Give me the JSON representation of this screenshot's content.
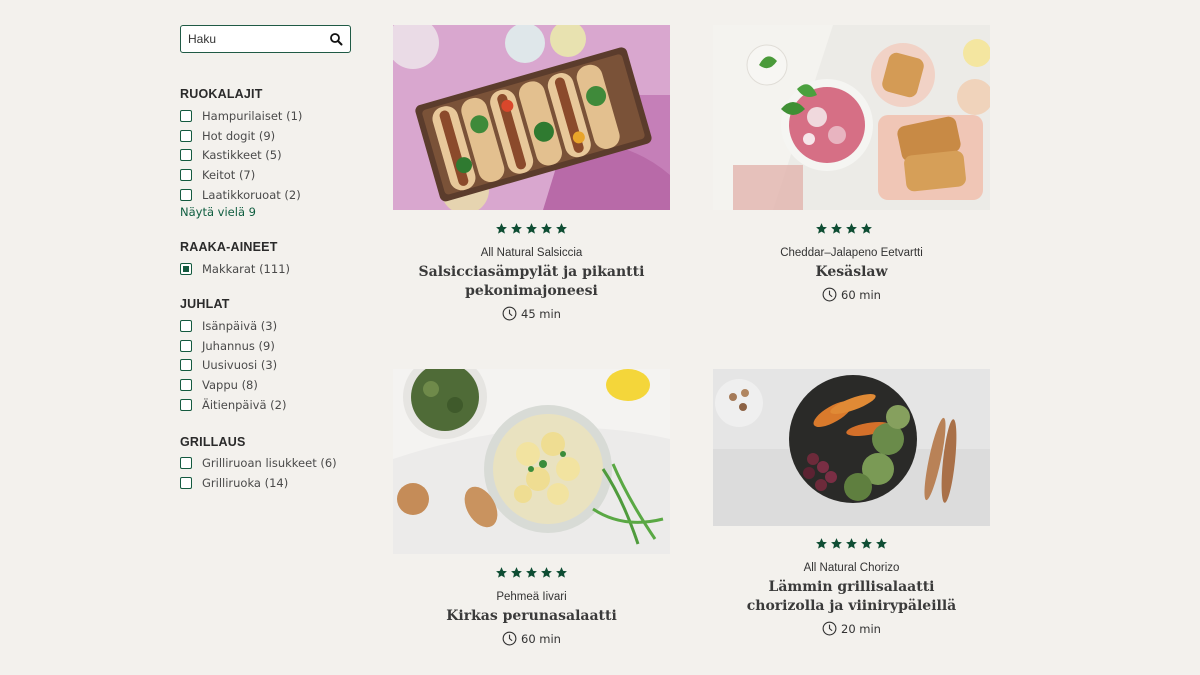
{
  "search": {
    "placeholder": "Haku"
  },
  "filters": [
    {
      "title": "RUOKALAJIT",
      "options": [
        {
          "label": "Hampurilaiset (1)",
          "checked": false
        },
        {
          "label": "Hot dogit (9)",
          "checked": false
        },
        {
          "label": "Kastikkeet (5)",
          "checked": false
        },
        {
          "label": "Keitot (7)",
          "checked": false
        },
        {
          "label": "Laatikkoruoat (2)",
          "checked": false
        }
      ],
      "more": "Näytä vielä 9"
    },
    {
      "title": "RAAKA-AINEET",
      "options": [
        {
          "label": "Makkarat (111)",
          "checked": true
        }
      ]
    },
    {
      "title": "JUHLAT",
      "options": [
        {
          "label": "Isänpäivä (3)",
          "checked": false
        },
        {
          "label": "Juhannus (9)",
          "checked": false
        },
        {
          "label": "Uusivuosi (3)",
          "checked": false
        },
        {
          "label": "Vappu (8)",
          "checked": false
        },
        {
          "label": "Äitienpäivä (2)",
          "checked": false
        }
      ]
    },
    {
      "title": "GRILLAUS",
      "options": [
        {
          "label": "Grilliruoan lisukkeet (6)",
          "checked": false
        },
        {
          "label": "Grilliruoka (14)",
          "checked": false
        }
      ]
    }
  ],
  "recipes": [
    {
      "brand": "All Natural Salsiccia",
      "title": "Salsicciasämpylät ja pikantti pekonimajoneesi",
      "time": "45 min",
      "rating": 5,
      "image": "hot-dog-sandwiches-photo"
    },
    {
      "brand": "Cheddar–Jalapeno Eetvartti",
      "title": "Kesäslaw",
      "time": "60 min",
      "rating": 4,
      "image": "coleslaw-photo"
    },
    {
      "brand": "Pehmeä Iivari",
      "title": "Kirkas perunasalaatti",
      "time": "60 min",
      "rating": 5,
      "image": "potato-salad-photo"
    },
    {
      "brand": "All Natural Chorizo",
      "title": "Lämmin grillisalaatti chorizolla ja viinirypäleillä",
      "time": "20 min",
      "rating": 5,
      "image": "grill-salad-photo"
    }
  ],
  "colors": {
    "accent": "#145a3f",
    "background": "#f3f1ed"
  }
}
